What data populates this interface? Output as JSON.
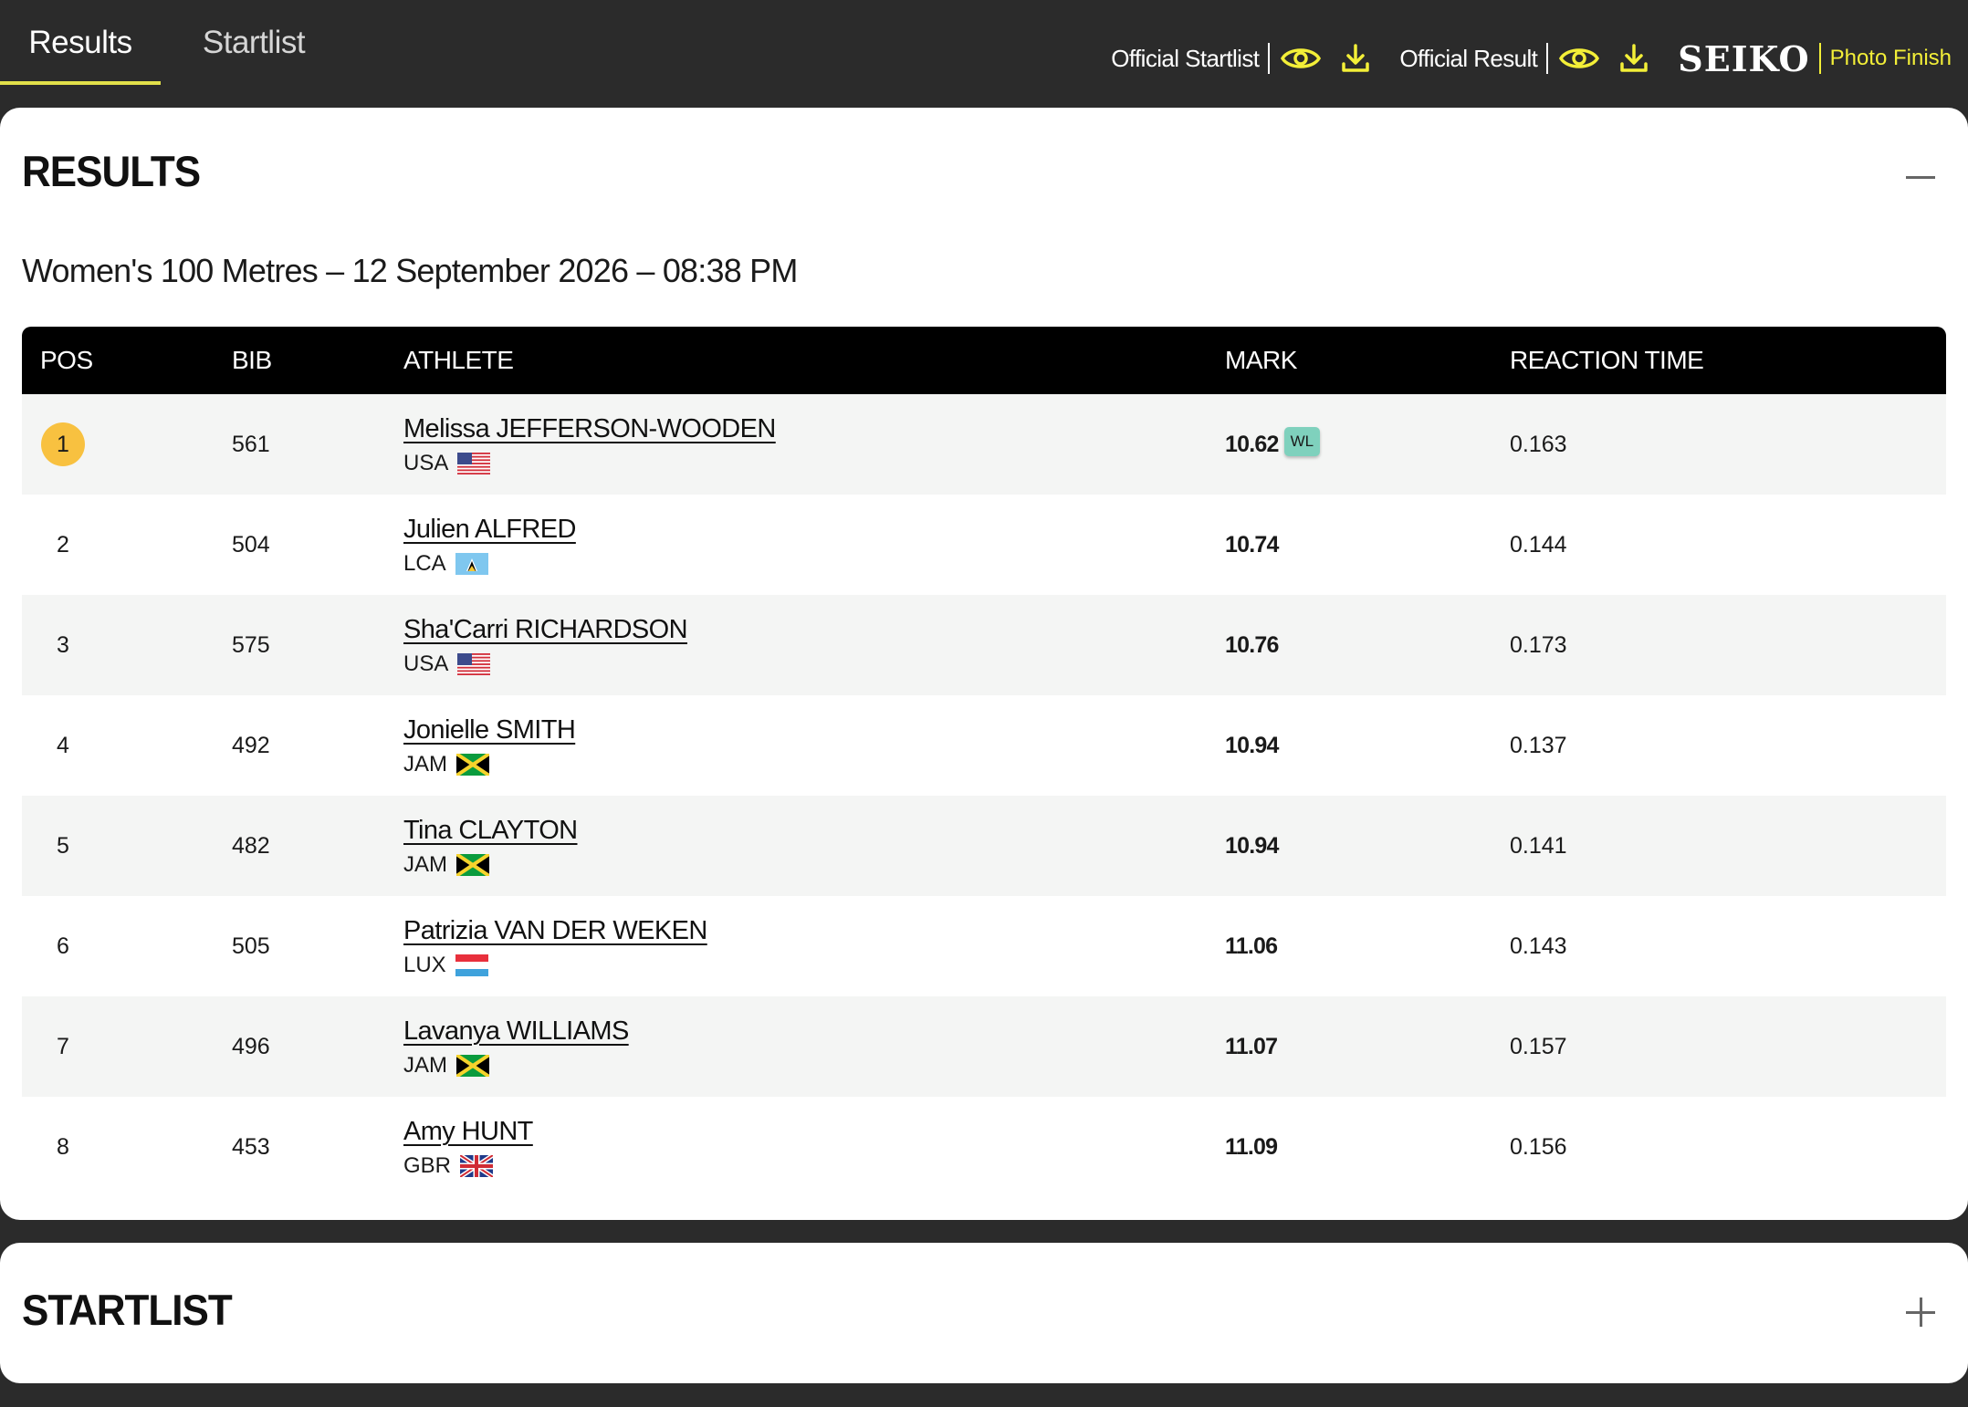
{
  "tabs": [
    {
      "label": "Results",
      "active": true
    },
    {
      "label": "Startlist",
      "active": false
    }
  ],
  "docs": {
    "official_startlist": "Official Startlist",
    "official_result": "Official Result",
    "brand": "SEIKO",
    "photo_finish": "Photo Finish"
  },
  "results_section": {
    "title": "RESULTS",
    "event_title": "Women's 100 Metres – 12 September 2026 – 08:38 PM",
    "columns": {
      "pos": "POS",
      "bib": "BIB",
      "athlete": "ATHLETE",
      "mark": "MARK",
      "reaction": "REACTION TIME"
    },
    "rows": [
      {
        "pos": "1",
        "bib": "561",
        "name": "Melissa JEFFERSON-WOODEN",
        "country": "USA",
        "flag": "usa",
        "mark": "10.62",
        "badge": "WL",
        "reaction": "0.163"
      },
      {
        "pos": "2",
        "bib": "504",
        "name": "Julien ALFRED",
        "country": "LCA",
        "flag": "lca",
        "mark": "10.74",
        "badge": "",
        "reaction": "0.144"
      },
      {
        "pos": "3",
        "bib": "575",
        "name": "Sha'Carri RICHARDSON",
        "country": "USA",
        "flag": "usa",
        "mark": "10.76",
        "badge": "",
        "reaction": "0.173"
      },
      {
        "pos": "4",
        "bib": "492",
        "name": "Jonielle SMITH",
        "country": "JAM",
        "flag": "jam",
        "mark": "10.94",
        "badge": "",
        "reaction": "0.137"
      },
      {
        "pos": "5",
        "bib": "482",
        "name": "Tina CLAYTON",
        "country": "JAM",
        "flag": "jam",
        "mark": "10.94",
        "badge": "",
        "reaction": "0.141"
      },
      {
        "pos": "6",
        "bib": "505",
        "name": "Patrizia VAN DER WEKEN",
        "country": "LUX",
        "flag": "lux",
        "mark": "11.06",
        "badge": "",
        "reaction": "0.143"
      },
      {
        "pos": "7",
        "bib": "496",
        "name": "Lavanya WILLIAMS",
        "country": "JAM",
        "flag": "jam",
        "mark": "11.07",
        "badge": "",
        "reaction": "0.157"
      },
      {
        "pos": "8",
        "bib": "453",
        "name": "Amy HUNT",
        "country": "GBR",
        "flag": "gbr",
        "mark": "11.09",
        "badge": "",
        "reaction": "0.156"
      }
    ]
  },
  "startlist_section": {
    "title": "STARTLIST"
  },
  "colors": {
    "accent_yellow": "#f3ef38",
    "gold_medal": "#f8c140",
    "wl_badge": "#7fd1bd",
    "header_bg": "#2b2b2b"
  }
}
